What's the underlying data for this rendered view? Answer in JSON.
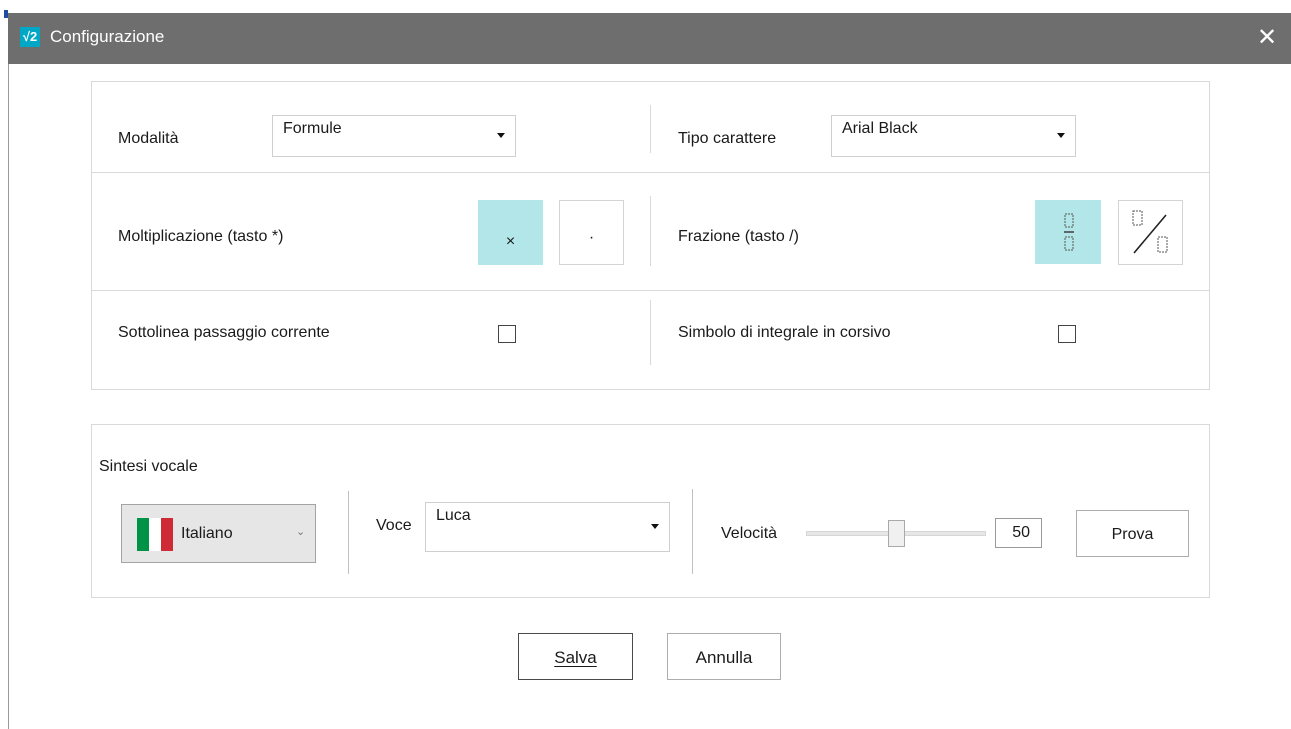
{
  "window": {
    "title": "Configurazione",
    "app_icon": "√2"
  },
  "settings": {
    "modalita_label": "Modalità",
    "modalita_value": "Formule",
    "font_label": "Tipo carattere",
    "font_value": "Arial Black",
    "multiplication_label": "Moltiplicazione (tasto *)",
    "multiplication_options": [
      "×",
      "·"
    ],
    "fraction_label": "Frazione (tasto /)",
    "underline_label": "Sottolinea passaggio corrente",
    "underline_checked": false,
    "integral_label": "Simbolo di integrale in corsivo",
    "integral_checked": false
  },
  "speech": {
    "section_label": "Sintesi vocale",
    "language": "Italiano",
    "language_flag_colors": [
      "#009246",
      "#ffffff",
      "#ce2b37"
    ],
    "voice_label": "Voce",
    "voice_value": "Luca",
    "speed_label": "Velocità",
    "speed_value": "50",
    "test_button": "Prova"
  },
  "footer": {
    "save_label": "Salva",
    "cancel_label": "Annulla"
  },
  "colors": {
    "titlebar": "#6e6e6e",
    "selected_toggle": "#b2e6e8"
  }
}
